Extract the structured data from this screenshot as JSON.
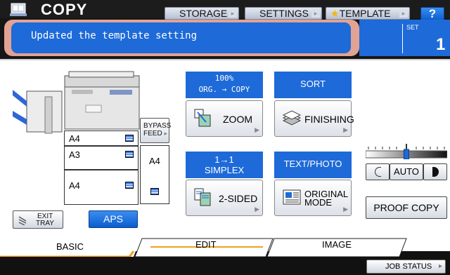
{
  "header": {
    "app_title": "COPY",
    "tabs": [
      {
        "label": "STORAGE"
      },
      {
        "label": "SETTINGS"
      },
      {
        "label": "TEMPLATE"
      }
    ],
    "help_label": "?"
  },
  "message": {
    "text": "Updated the template setting",
    "set_label": "SET",
    "set_value": "1"
  },
  "paper": {
    "trays": [
      {
        "size": "A4"
      },
      {
        "size": "A3"
      },
      {
        "size": "A4"
      }
    ],
    "bypass_label_1": "BYPASS",
    "bypass_label_2": "FEED",
    "bypass_size": "A4",
    "exit_tray_label_1": "EXIT",
    "exit_tray_label_2": "TRAY",
    "aps_label": "APS"
  },
  "functions": {
    "zoom": {
      "header_1": "100%",
      "header_2": "ORG. → COPY",
      "label": "ZOOM"
    },
    "finishing": {
      "header": "SORT",
      "label": "FINISHING"
    },
    "two_sided": {
      "header_1": "1→1",
      "header_2": "SIMPLEX",
      "label": "2-SIDED"
    },
    "original_mode": {
      "header": "TEXT/PHOTO",
      "label_1": "ORIGINAL",
      "label_2": "MODE"
    }
  },
  "density": {
    "auto_label": "AUTO",
    "level_fraction": 0.5
  },
  "proof_copy_label": "PROOF COPY",
  "bottom_tabs": [
    {
      "label": "BASIC"
    },
    {
      "label": "EDIT"
    },
    {
      "label": "IMAGE"
    }
  ],
  "job_status_label": "JOB STATUS",
  "colors": {
    "accent_blue": "#1e6ad8",
    "highlight": "#e2a393",
    "tab_underline": "#f0a020"
  }
}
